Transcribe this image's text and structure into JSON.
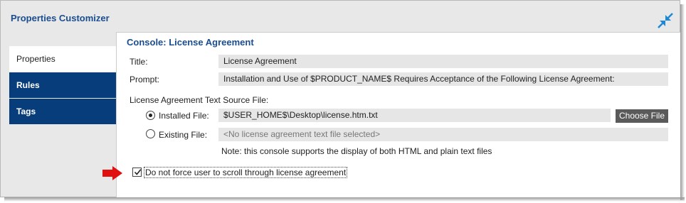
{
  "window": {
    "title": "Properties Customizer"
  },
  "icons": {
    "collapse": "collapse-arrows-icon",
    "pointer": "red-arrow-icon"
  },
  "colors": {
    "title_blue": "#1a4d8f",
    "tab_blue": "#073d7a",
    "arrow_red": "#e01010",
    "icon_blue": "#1e88d8"
  },
  "tabs": [
    {
      "label": "Properties",
      "active": true
    },
    {
      "label": "Rules",
      "active": false
    },
    {
      "label": "Tags",
      "active": false
    }
  ],
  "panel": {
    "heading": "Console: License Agreement",
    "title_label": "Title:",
    "title_value": "License Agreement",
    "prompt_label": "Prompt:",
    "prompt_value": "Installation and Use of $PRODUCT_NAME$ Requires Acceptance of the Following License Agreement:",
    "source_label": "License Agreement Text Source File:",
    "installed_label": "Installed File:",
    "installed_value": "$USER_HOME$\\Desktop\\license.htm.txt",
    "choose_label": "Choose File",
    "existing_label": "Existing File:",
    "existing_placeholder": "<No license agreement text file selected>",
    "note": "Note: this console supports the display of both HTML and plain text files",
    "checkbox_label": "Do not force user to scroll through license agreement",
    "checkbox_checked": true,
    "selected_source": "installed"
  }
}
